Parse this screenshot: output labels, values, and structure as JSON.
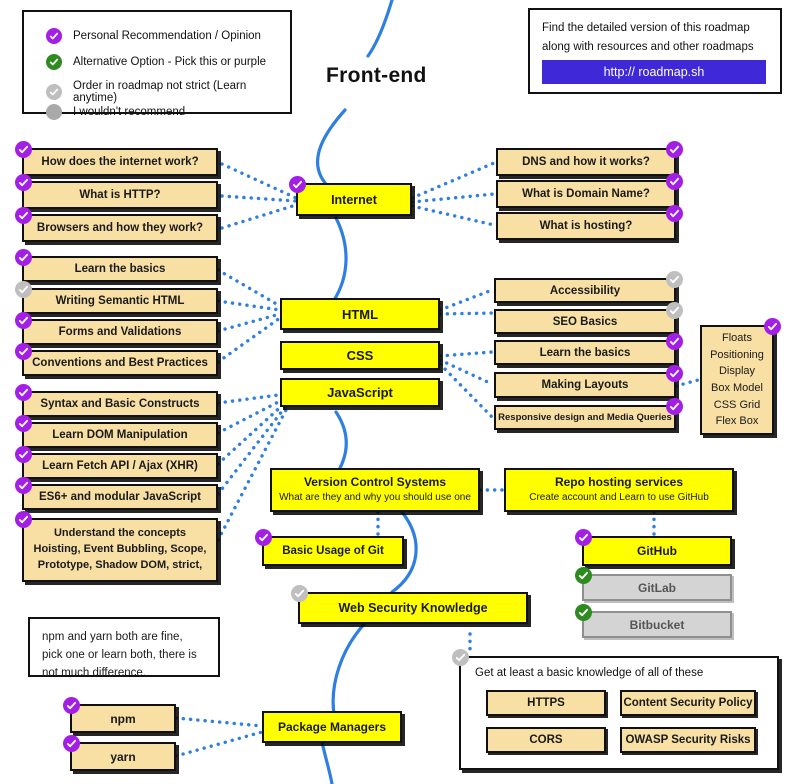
{
  "title": "Front-end",
  "colors": {
    "primary_node": "#FFFF00",
    "secondary_node": "#F8DFA4",
    "disabled_node": "#D4D4D4",
    "spine": "#2E7FE0",
    "connector": "#2E7FE0",
    "badge_recommended": "#A41FE6",
    "badge_alternative": "#2E8B20",
    "badge_optional": "#BFBFBF",
    "badge_not_recommended": "#A9A9A9",
    "url_button": "#3F28D8"
  },
  "legend": {
    "items": [
      {
        "badge": "purple",
        "icon": "check-circle-icon",
        "label": "Personal Recommendation / Opinion"
      },
      {
        "badge": "green",
        "icon": "check-circle-icon",
        "label": "Alternative Option - Pick this or purple"
      },
      {
        "badge": "gray",
        "icon": "check-circle-icon",
        "label": "Order in roadmap not strict (Learn anytime)"
      },
      {
        "badge": "graysolid",
        "icon": "filled-circle-icon",
        "label": "I wouldn't recommend"
      }
    ]
  },
  "promo": {
    "line1": "Find the detailed version of this roadmap",
    "line2": "along with resources and other roadmaps",
    "url_label": "http:// roadmap.sh"
  },
  "nodes": {
    "internet": "Internet",
    "html": "HTML",
    "css": "CSS",
    "javascript": "JavaScript",
    "version_control_title": "Version Control Systems",
    "version_control_sub": "What are they and why you should use one",
    "repo_hosting_title": "Repo hosting services",
    "repo_hosting_sub": "Create account and Learn to use GitHub",
    "basic_git": "Basic Usage of Git",
    "github": "GitHub",
    "gitlab": "GitLab",
    "bitbucket": "Bitbucket",
    "web_security": "Web Security Knowledge",
    "package_managers": "Package Managers",
    "npm": "npm",
    "yarn": "yarn"
  },
  "internet_left": [
    {
      "label": "How does the internet work?",
      "badge": "purple"
    },
    {
      "label": "What is HTTP?",
      "badge": "purple"
    },
    {
      "label": "Browsers and how they work?",
      "badge": "purple"
    }
  ],
  "internet_right": [
    {
      "label": "DNS and how it works?",
      "badge": "purple"
    },
    {
      "label": "What is Domain Name?",
      "badge": "purple"
    },
    {
      "label": "What is hosting?",
      "badge": "purple"
    }
  ],
  "html_left": [
    {
      "label": "Learn the basics",
      "badge": "purple"
    },
    {
      "label": "Writing Semantic HTML",
      "badge": "gray"
    },
    {
      "label": "Forms and Validations",
      "badge": "purple"
    },
    {
      "label": "Conventions and Best Practices",
      "badge": "purple"
    }
  ],
  "html_css_right": [
    {
      "label": "Accessibility",
      "badge": "gray"
    },
    {
      "label": "SEO Basics",
      "badge": "gray"
    },
    {
      "label": "Learn the basics",
      "badge": "purple"
    },
    {
      "label": "Making Layouts",
      "badge": "purple"
    },
    {
      "label": "Responsive design and Media Queries",
      "badge": "purple"
    }
  ],
  "css_props": {
    "badge": "purple",
    "items": [
      "Floats",
      "Positioning",
      "Display",
      "Box Model",
      "CSS Grid",
      "Flex Box"
    ]
  },
  "js_left": [
    {
      "label": "Syntax and Basic Constructs",
      "badge": "purple"
    },
    {
      "label": "Learn DOM Manipulation",
      "badge": "purple"
    },
    {
      "label": "Learn Fetch API / Ajax (XHR)",
      "badge": "purple"
    },
    {
      "label": "ES6+ and modular JavaScript",
      "badge": "purple"
    }
  ],
  "js_concepts": {
    "badge": "purple",
    "lines": [
      "Understand the concepts",
      "Hoisting, Event Bubbling, Scope,",
      "Prototype, Shadow DOM, strict,"
    ]
  },
  "npm_note": "npm and yarn both are fine, pick one or learn both, there is not much difference.",
  "security_panel": {
    "badge": "gray",
    "caption": "Get at least a basic knowledge of all of these",
    "items": [
      "HTTPS",
      "Content Security Policy",
      "CORS",
      "OWASP Security Risks"
    ]
  }
}
